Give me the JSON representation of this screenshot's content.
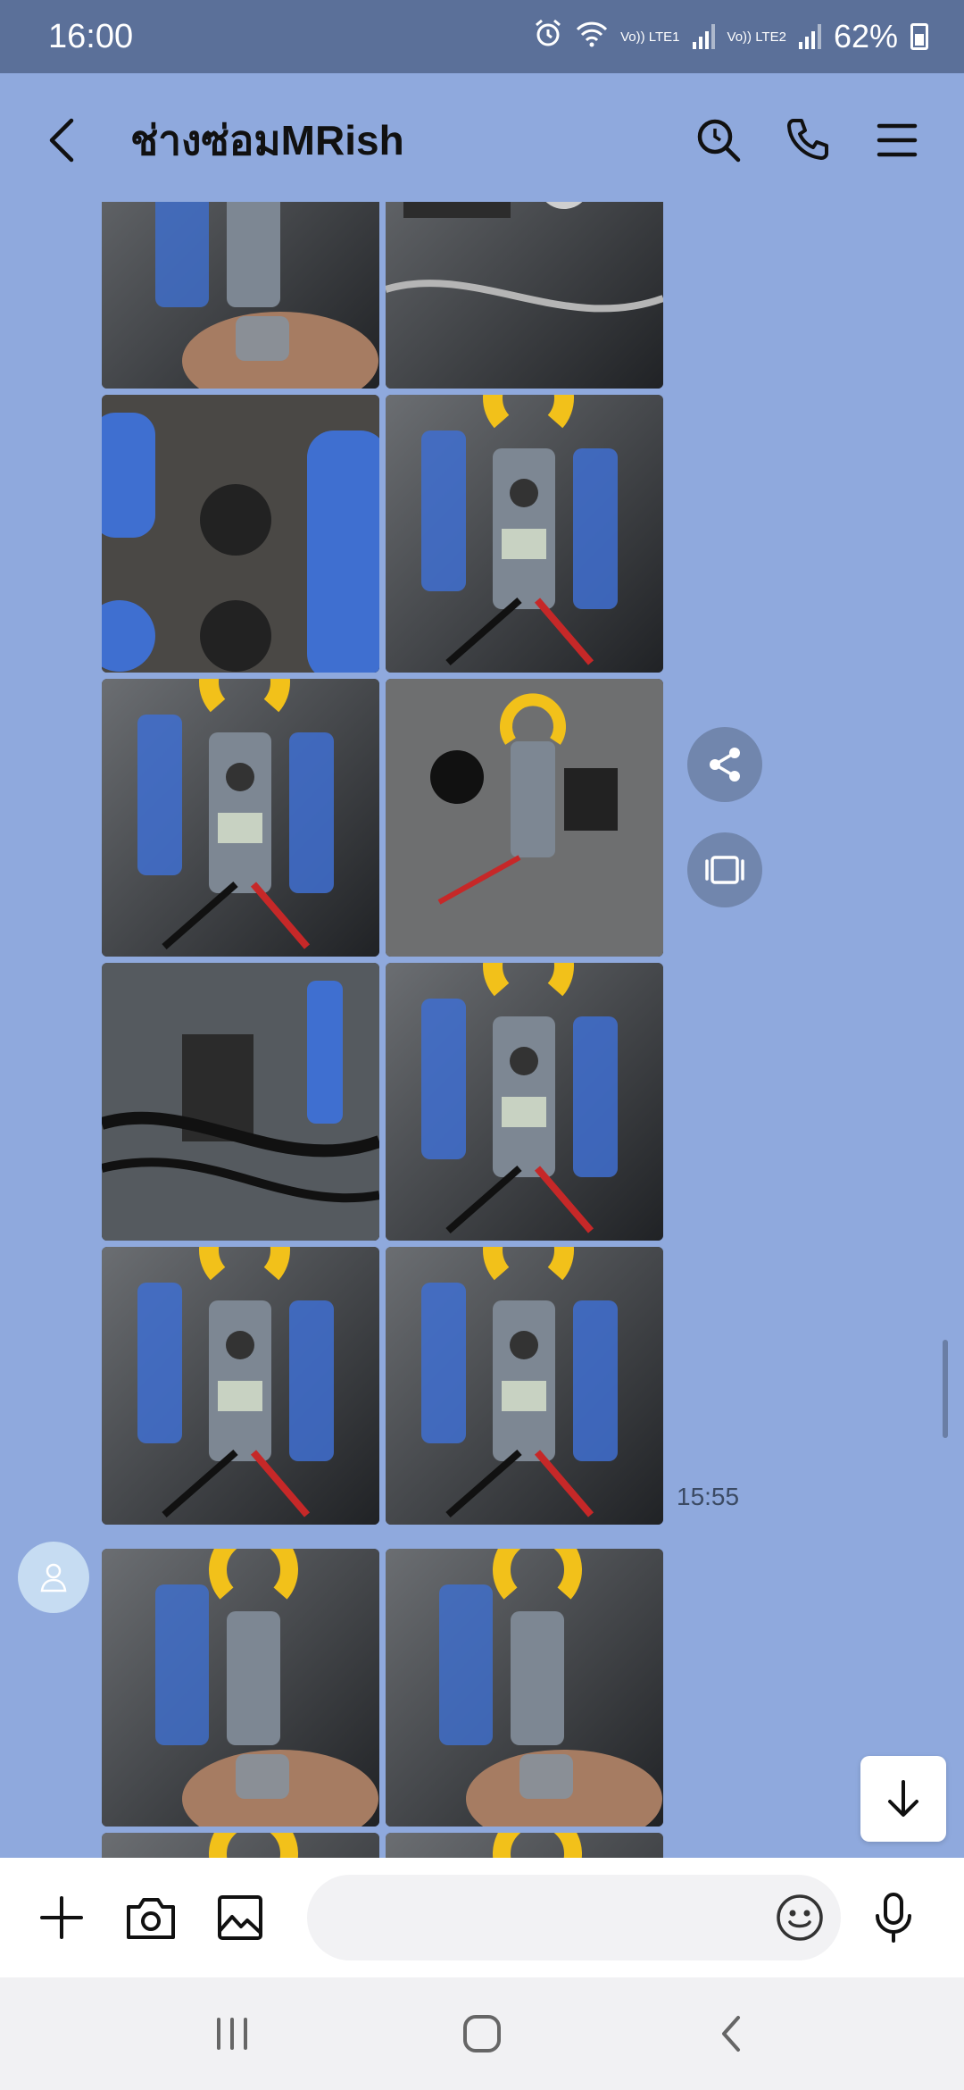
{
  "status_bar": {
    "time": "16:00",
    "sim1": "Vo)) LTE1",
    "sim2": "Vo)) LTE2",
    "battery": "62%"
  },
  "header": {
    "title": "ช่างซ่อมMRish",
    "icons": [
      "back-icon",
      "search-icon",
      "phone-icon",
      "menu-icon"
    ]
  },
  "messages": [
    {
      "sender": "self",
      "photos": 12,
      "time": "15:55"
    },
    {
      "sender": "other",
      "photos": 4
    }
  ],
  "input_bar": {
    "placeholder": "",
    "icons": [
      "plus-icon",
      "camera-icon",
      "image-icon",
      "emoji-icon",
      "mic-icon"
    ]
  },
  "floating_actions": [
    "share-icon",
    "expand-icon",
    "scroll-down-icon"
  ],
  "nav_bar": [
    "recent-apps-icon",
    "home-icon",
    "back-icon"
  ],
  "colors": {
    "chat_background": "#8fa9dd",
    "status_bar": "#5b7099",
    "clamp_meter_yellow": "#f2c11a",
    "battery_cap_blue": "#3f6fd0"
  }
}
